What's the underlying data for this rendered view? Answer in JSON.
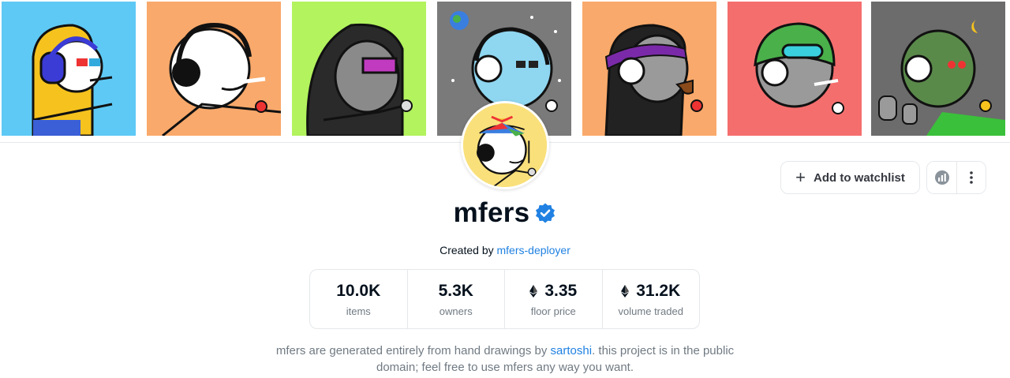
{
  "banner": {
    "tiles": [
      {
        "name": "mfer-tile-1",
        "bg": "#5ec9f5"
      },
      {
        "name": "mfer-tile-2",
        "bg": "#f9a96b"
      },
      {
        "name": "mfer-tile-3",
        "bg": "#b2f35e"
      },
      {
        "name": "mfer-tile-4",
        "bg": "#7a7a7a"
      },
      {
        "name": "mfer-tile-5",
        "bg": "#f9a96b"
      },
      {
        "name": "mfer-tile-6",
        "bg": "#f56e6e"
      },
      {
        "name": "mfer-tile-7",
        "bg": "#6c6c6c"
      }
    ]
  },
  "collection": {
    "title": "mfers",
    "created_by_prefix": "Created by",
    "creator": "mfers-deployer",
    "verified_icon": "verified-badge-icon"
  },
  "actions": {
    "watchlist_label": "Add to watchlist",
    "watchlist_icon": "plus-icon",
    "stats_icon": "chart-icon",
    "more_icon": "more-vertical-icon"
  },
  "stats": [
    {
      "value": "10.0K",
      "label": "items",
      "eth": false
    },
    {
      "value": "5.3K",
      "label": "owners",
      "eth": false
    },
    {
      "value": "3.35",
      "label": "floor price",
      "eth": true
    },
    {
      "value": "31.2K",
      "label": "volume traded",
      "eth": true
    }
  ],
  "description": {
    "before_link": "mfers are generated entirely from hand drawings by ",
    "link": "sartoshi",
    "after_link": ". this project is in the public domain; feel free to use mfers any way you want."
  },
  "colors": {
    "accent": "#2081e2",
    "text": "#04111d",
    "muted": "#707a83",
    "border": "#e5e8eb"
  }
}
